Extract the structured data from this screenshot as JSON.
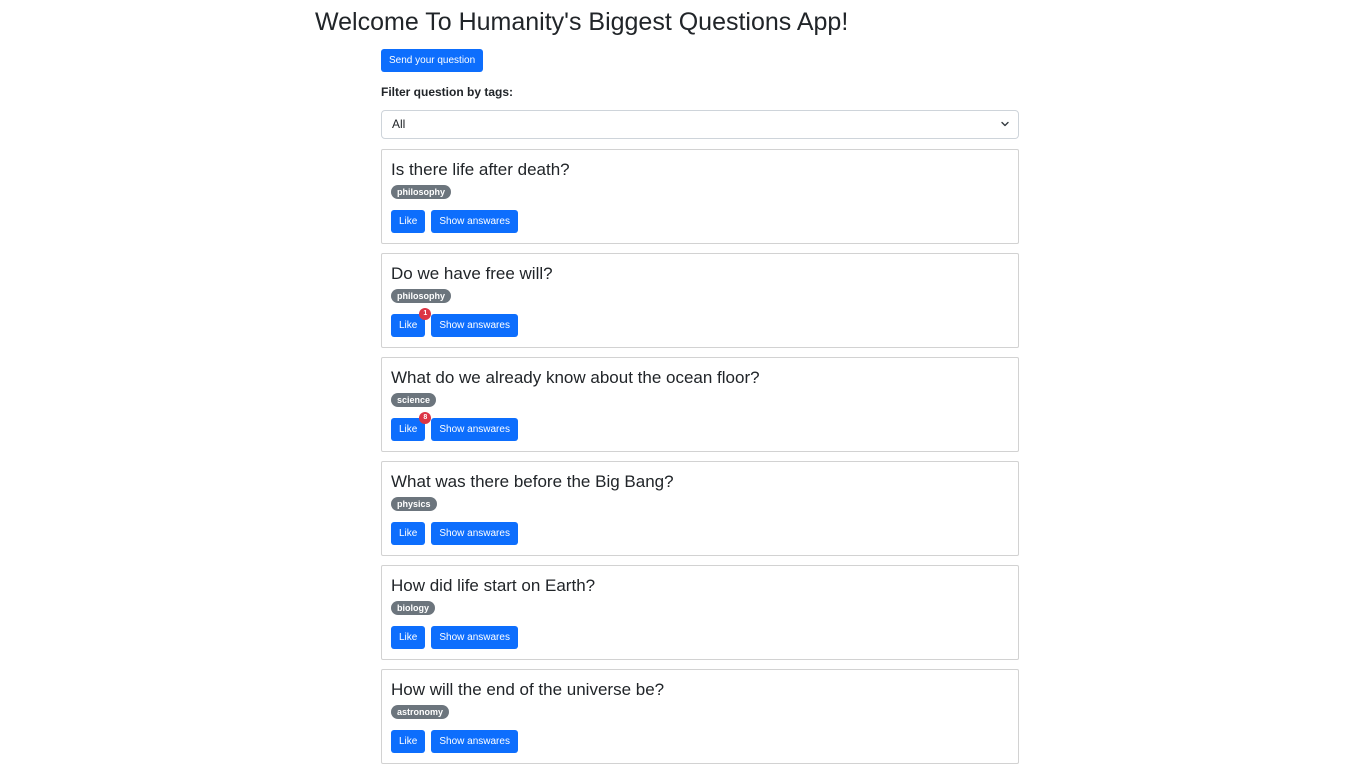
{
  "header": {
    "title": "Welcome To Humanity's Biggest Questions App!"
  },
  "toolbar": {
    "send_label": "Send your question"
  },
  "filter": {
    "label": "Filter question by tags:",
    "selected": "All"
  },
  "questions": [
    {
      "title": "Is there life after death?",
      "tag": "philosophy",
      "like_label": "Like",
      "likes": "",
      "answers_label": "Show answares"
    },
    {
      "title": "Do we have free will?",
      "tag": "philosophy",
      "like_label": "Like",
      "likes": "1",
      "answers_label": "Show answares"
    },
    {
      "title": "What do we already know about the ocean floor?",
      "tag": "science",
      "like_label": "Like",
      "likes": "8",
      "answers_label": "Show answares"
    },
    {
      "title": "What was there before the Big Bang?",
      "tag": "physics",
      "like_label": "Like",
      "likes": "",
      "answers_label": "Show answares"
    },
    {
      "title": "How did life start on Earth?",
      "tag": "biology",
      "like_label": "Like",
      "likes": "",
      "answers_label": "Show answares"
    },
    {
      "title": "How will the end of the universe be?",
      "tag": "astronomy",
      "like_label": "Like",
      "likes": "",
      "answers_label": "Show answares"
    }
  ],
  "colors": {
    "primary": "#0d6efd",
    "tag": "#6c757d",
    "like_badge": "#dc3545"
  }
}
